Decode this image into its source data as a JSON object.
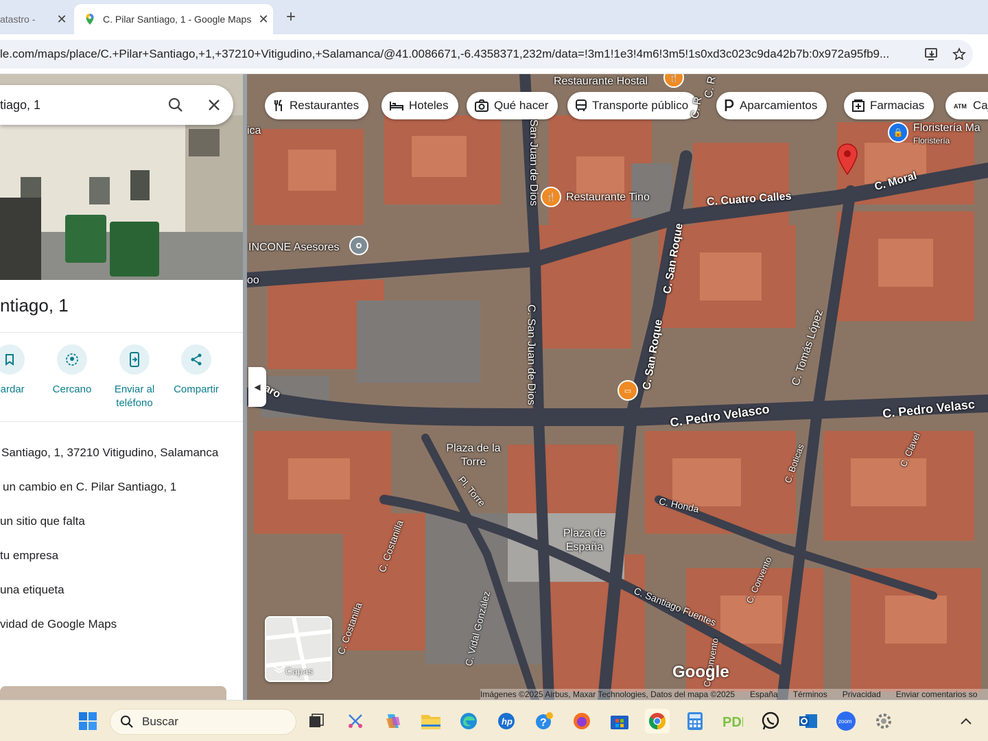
{
  "browser": {
    "tabs": [
      {
        "title": "atastro -",
        "active": false
      },
      {
        "title": "C. Pilar Santiago, 1 - Google Maps",
        "active": true
      }
    ],
    "url": "le.com/maps/place/C.+Pilar+Santiago,+1,+37210+Vitigudino,+Salamanca/@41.0086671,-6.4358371,232m/data=!3m1!1e3!4m6!3m5!1s0xd3c023c9da42b7b:0x972a95fb9..."
  },
  "panel": {
    "search_value": "tiago, 1",
    "title": "ntiago, 1",
    "actions": [
      {
        "label": "uardar",
        "icon": "bookmark-icon"
      },
      {
        "label": "Cercano",
        "icon": "nearby-icon"
      },
      {
        "label": "Enviar al teléfono",
        "icon": "send-to-phone-icon"
      },
      {
        "label": "Compartir",
        "icon": "share-icon"
      }
    ],
    "info": [
      "Santiago, 1, 37210 Vitigudino, Salamanca",
      "un cambio en C. Pilar Santiago, 1",
      "un sitio que falta",
      "tu empresa",
      "una etiqueta",
      "vidad de Google Maps"
    ]
  },
  "map": {
    "chips": [
      {
        "label": "Restaurantes",
        "icon": "fork-knife-icon"
      },
      {
        "label": "Hoteles",
        "icon": "bed-icon"
      },
      {
        "label": "Qué hacer",
        "icon": "camera-icon"
      },
      {
        "label": "Transporte público",
        "icon": "bus-icon"
      },
      {
        "label": "Aparcamientos",
        "icon": "parking-icon"
      },
      {
        "label": "Farmacias",
        "icon": "pharmacy-icon"
      },
      {
        "label": "Caj",
        "icon": "atm-icon"
      }
    ],
    "places": [
      {
        "name": "Restaurante Hostal"
      },
      {
        "name": "Restaurante Tino"
      },
      {
        "name": "INCONE Asesores"
      },
      {
        "name": "Floristería Ma",
        "sub": "Floristería"
      }
    ],
    "streets": [
      "C. Cuatro Calles",
      "C. Moral",
      "C. San Roque",
      "C. San Roque",
      "San Juan de Dios",
      "C. San Juan de Dios",
      "C. Tomás López",
      "C. Pedro Velasco",
      "C. Pedro Velasc",
      "C. Boticas",
      "C. Clavel",
      "C. Honda",
      "C. Costanilla",
      "C. Costanilla",
      "C. Vidal González",
      "C. Santiago Fuentes",
      "C. Convento",
      "C. Convento",
      "Pl. Torre",
      "aro",
      "C. R",
      "C. R",
      "ica",
      "oo"
    ],
    "squares": [
      "Plaza de la Torre",
      "Plaza de España"
    ],
    "layers_label": "Capas",
    "logo": "Google",
    "attribution": [
      "Imágenes ©2025 Airbus, Maxar Technologies, Datos del mapa ©2025",
      "España",
      "Términos",
      "Privacidad",
      "Enviar comentarios so"
    ]
  },
  "taskbar": {
    "search_placeholder": "Buscar",
    "apps": [
      "windows-start-icon",
      "task-view-icon",
      "snipping-tool-icon",
      "copilot-icon",
      "file-explorer-icon",
      "edge-icon",
      "hp-icon",
      "get-help-icon",
      "firefox-icon",
      "microsoft-store-icon",
      "chrome-icon",
      "calculator-icon",
      "pdf-icon",
      "whatsapp-icon",
      "outlook-icon",
      "zoom-icon",
      "settings-icon"
    ]
  },
  "colors": {
    "accent": "#0b7d8c",
    "marker": "#e53935",
    "poi_orange": "#f08a24",
    "poi_blue": "#1a73e8"
  }
}
